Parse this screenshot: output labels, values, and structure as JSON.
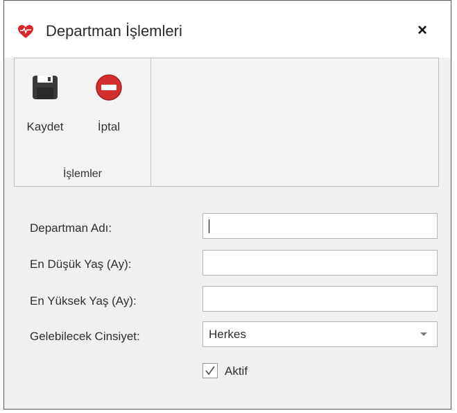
{
  "window": {
    "title": "Departman İşlemleri",
    "close_glyph": "×",
    "app_icon": "heart-icon"
  },
  "ribbon": {
    "group_label": "İşlemler",
    "buttons": [
      {
        "label": "Kaydet",
        "icon": "floppy-disk-icon"
      },
      {
        "label": "İptal",
        "icon": "stop-icon"
      }
    ]
  },
  "form": {
    "fields": [
      {
        "label": "Departman Adı:",
        "value": ""
      },
      {
        "label": "En Düşük  Yaş (Ay):",
        "value": ""
      },
      {
        "label": "En Yüksek  Yaş (Ay):",
        "value": ""
      }
    ],
    "gender": {
      "label": "Gelebilecek Cinsiyet:",
      "value": "Herkes"
    },
    "active": {
      "label": "Aktif",
      "checked": true
    }
  },
  "colors": {
    "heart": "#d9262b",
    "stop_red": "#d32f2f",
    "floppy": "#3a3a3a",
    "window_bg": "#f0f0f0"
  }
}
